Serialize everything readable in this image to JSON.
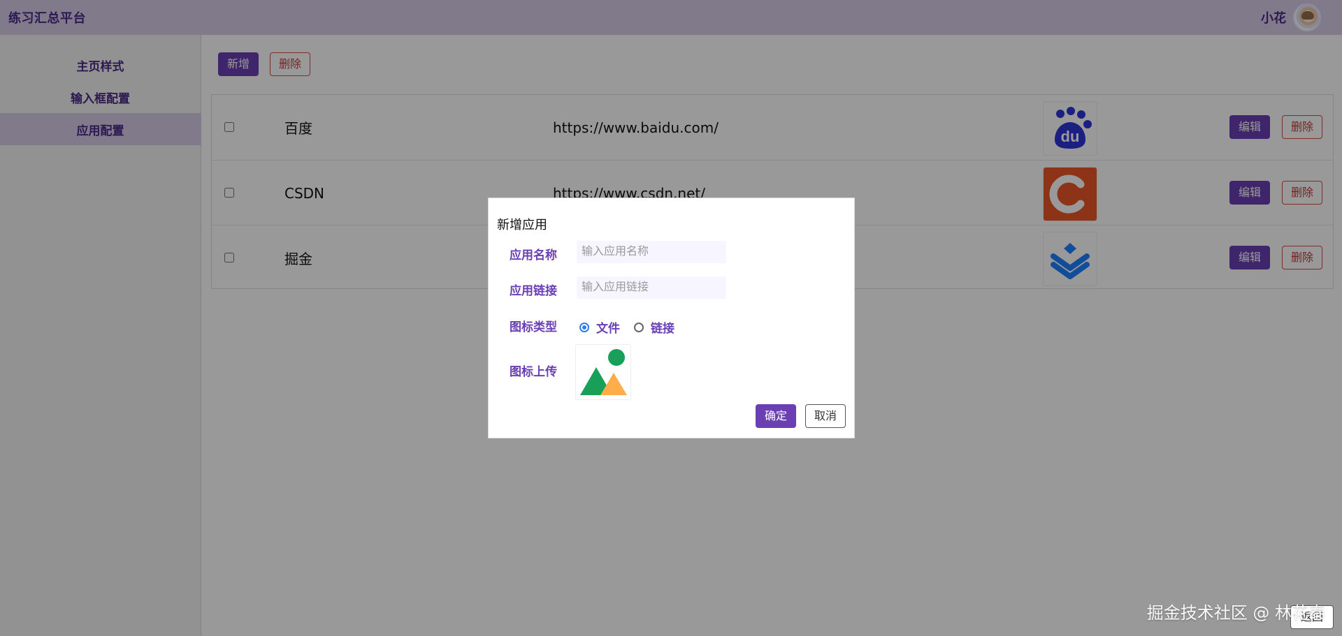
{
  "app": {
    "title": "练习汇总平台",
    "user_name": "小花"
  },
  "sidebar": {
    "items": [
      {
        "label": "主页样式"
      },
      {
        "label": "输入框配置"
      },
      {
        "label": "应用配置"
      }
    ]
  },
  "toolbar": {
    "add_label": "新增",
    "delete_label": "删除"
  },
  "table": {
    "rows": [
      {
        "name": "百度",
        "url": "https://www.baidu.com/",
        "icon": "baidu-logo-icon",
        "edit_label": "编辑",
        "delete_label": "删除"
      },
      {
        "name": "CSDN",
        "url": "https://www.csdn.net/",
        "icon": "csdn-logo-icon",
        "edit_label": "编辑",
        "delete_label": "删除"
      },
      {
        "name": "掘金",
        "url": "",
        "icon": "juejin-logo-icon",
        "edit_label": "编辑",
        "delete_label": "删除"
      }
    ]
  },
  "dialog": {
    "title": "新增应用",
    "name_label": "应用名称",
    "name_placeholder": "输入应用名称",
    "link_label": "应用链接",
    "link_placeholder": "输入应用链接",
    "icon_type_label": "图标类型",
    "icon_type_options": [
      {
        "label": "文件",
        "selected": true
      },
      {
        "label": "链接",
        "selected": false
      }
    ],
    "icon_upload_label": "图标上传",
    "confirm_label": "确定",
    "cancel_label": "取消"
  },
  "watermark": {
    "text": "掘金技术社区 @ 林花泰"
  },
  "corner_button": {
    "label": "返回"
  },
  "colors": {
    "header_bg": "#d8cbe8",
    "accent": "#6a3fb4",
    "danger": "#c23b3b",
    "radio_blue": "#2f7be8"
  }
}
